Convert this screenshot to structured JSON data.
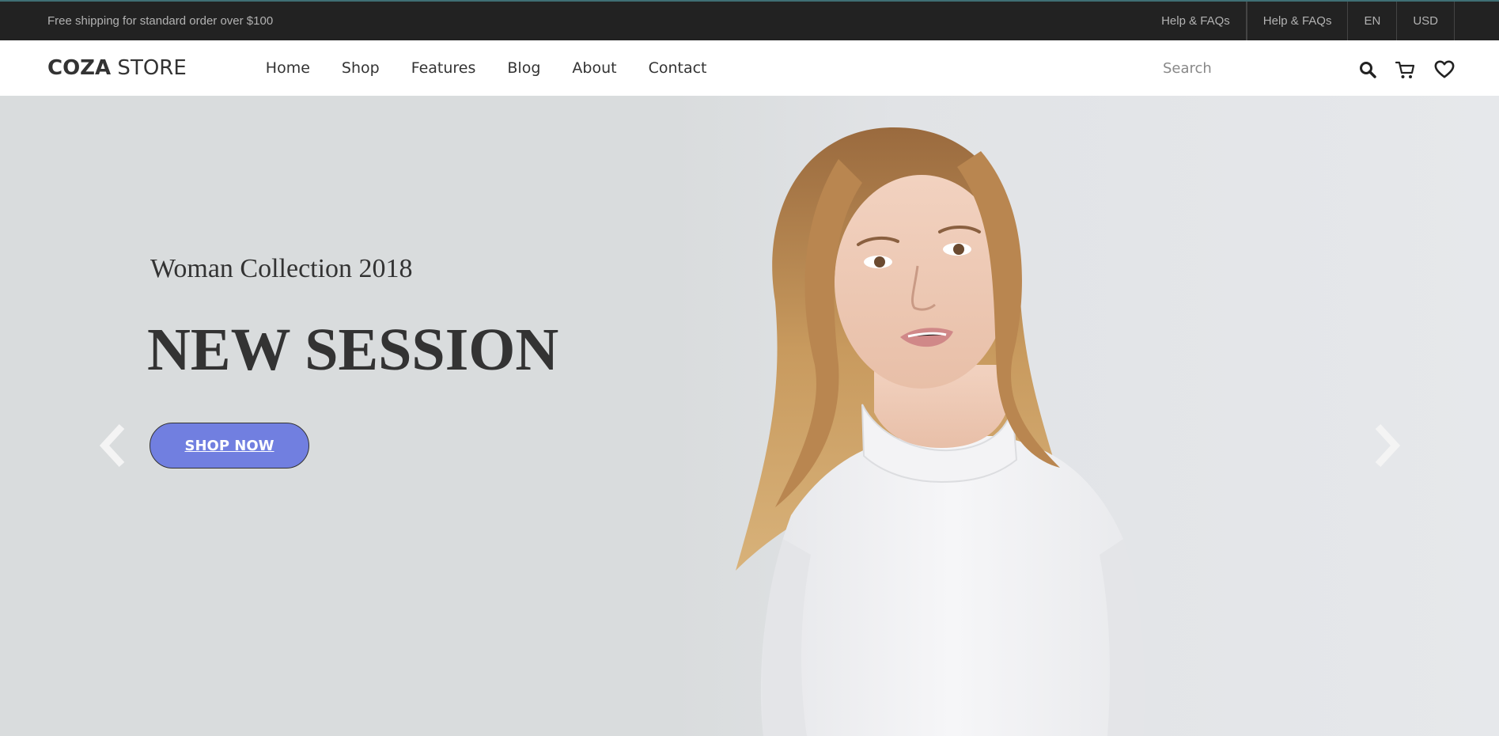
{
  "topbar": {
    "shipping_text": "Free shipping for standard order over $100",
    "links": [
      "Help & FAQs",
      "Help & FAQs",
      "EN",
      "USD"
    ]
  },
  "header": {
    "logo_bold": "COZA",
    "logo_light": " STORE",
    "nav": [
      "Home",
      "Shop",
      "Features",
      "Blog",
      "About",
      "Contact"
    ],
    "search_placeholder": "Search",
    "icons": [
      "search-icon",
      "cart-icon",
      "heart-icon"
    ]
  },
  "hero": {
    "subtitle": "Woman Collection 2018",
    "title": "NEW SESSION",
    "button_label": "SHOP NOW",
    "accent_color": "#717fe0"
  }
}
